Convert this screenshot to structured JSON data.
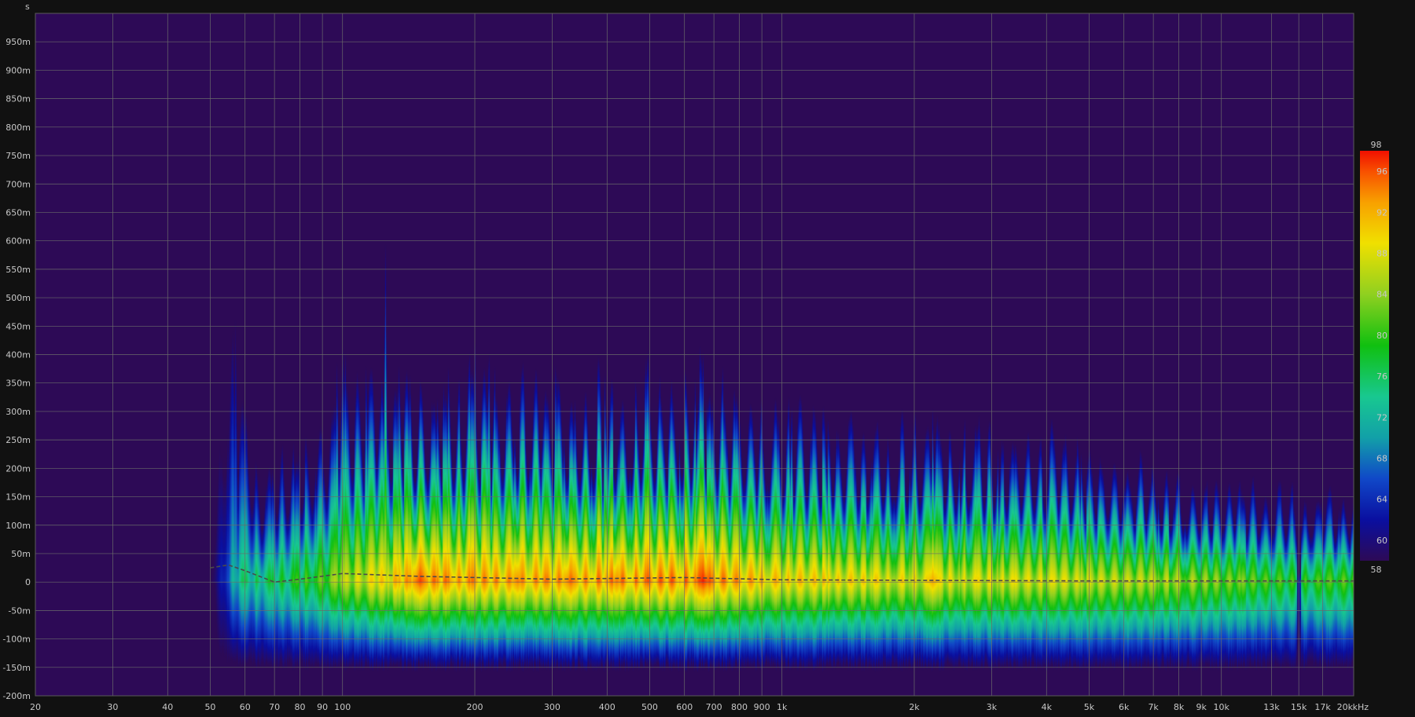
{
  "chart_data": {
    "type": "heatmap",
    "title": "",
    "y_unit_label": "s",
    "x_unit_label": "kHz",
    "xscale": "log",
    "xlim": [
      20,
      20000
    ],
    "ylim": [
      -0.2,
      1.0
    ],
    "grid": true,
    "x_ticks": [
      {
        "value": 20,
        "label": "20"
      },
      {
        "value": 30,
        "label": "30"
      },
      {
        "value": 40,
        "label": "40"
      },
      {
        "value": 50,
        "label": "50"
      },
      {
        "value": 60,
        "label": "60"
      },
      {
        "value": 70,
        "label": "70"
      },
      {
        "value": 80,
        "label": "80"
      },
      {
        "value": 90,
        "label": "90"
      },
      {
        "value": 100,
        "label": "100"
      },
      {
        "value": 200,
        "label": "200"
      },
      {
        "value": 300,
        "label": "300"
      },
      {
        "value": 400,
        "label": "400"
      },
      {
        "value": 500,
        "label": "500"
      },
      {
        "value": 600,
        "label": "600"
      },
      {
        "value": 700,
        "label": "700"
      },
      {
        "value": 800,
        "label": "800"
      },
      {
        "value": 900,
        "label": "900"
      },
      {
        "value": 1000,
        "label": "1k"
      },
      {
        "value": 2000,
        "label": "2k"
      },
      {
        "value": 3000,
        "label": "3k"
      },
      {
        "value": 4000,
        "label": "4k"
      },
      {
        "value": 5000,
        "label": "5k"
      },
      {
        "value": 6000,
        "label": "6k"
      },
      {
        "value": 7000,
        "label": "7k"
      },
      {
        "value": 8000,
        "label": "8k"
      },
      {
        "value": 9000,
        "label": "9k"
      },
      {
        "value": 10000,
        "label": "10k"
      },
      {
        "value": 13000,
        "label": "13k"
      },
      {
        "value": 15000,
        "label": "15k"
      },
      {
        "value": 17000,
        "label": "17k"
      },
      {
        "value": 20000,
        "label": "20k"
      }
    ],
    "y_ticks": [
      {
        "value": 0.95,
        "label": "950m"
      },
      {
        "value": 0.9,
        "label": "900m"
      },
      {
        "value": 0.85,
        "label": "850m"
      },
      {
        "value": 0.8,
        "label": "800m"
      },
      {
        "value": 0.75,
        "label": "750m"
      },
      {
        "value": 0.7,
        "label": "700m"
      },
      {
        "value": 0.65,
        "label": "650m"
      },
      {
        "value": 0.6,
        "label": "600m"
      },
      {
        "value": 0.55,
        "label": "550m"
      },
      {
        "value": 0.5,
        "label": "500m"
      },
      {
        "value": 0.45,
        "label": "450m"
      },
      {
        "value": 0.4,
        "label": "400m"
      },
      {
        "value": 0.35,
        "label": "350m"
      },
      {
        "value": 0.3,
        "label": "300m"
      },
      {
        "value": 0.25,
        "label": "250m"
      },
      {
        "value": 0.2,
        "label": "200m"
      },
      {
        "value": 0.15,
        "label": "150m"
      },
      {
        "value": 0.1,
        "label": "100m"
      },
      {
        "value": 0.05,
        "label": "50m"
      },
      {
        "value": 0,
        "label": "0"
      },
      {
        "value": -0.05,
        "label": "-50m"
      },
      {
        "value": -0.1,
        "label": "-100m"
      },
      {
        "value": -0.15,
        "label": "-150m"
      },
      {
        "value": -0.2,
        "label": "-200m"
      }
    ],
    "colorbar": {
      "min": 58,
      "max": 98,
      "ticks": [
        {
          "value": 98,
          "label": "98"
        },
        {
          "value": 96,
          "label": "96"
        },
        {
          "value": 92,
          "label": "92"
        },
        {
          "value": 88,
          "label": "88"
        },
        {
          "value": 84,
          "label": "84"
        },
        {
          "value": 80,
          "label": "80"
        },
        {
          "value": 76,
          "label": "76"
        },
        {
          "value": 72,
          "label": "72"
        },
        {
          "value": 68,
          "label": "68"
        },
        {
          "value": 64,
          "label": "64"
        },
        {
          "value": 60,
          "label": "60"
        },
        {
          "value": 58,
          "label": "58"
        }
      ],
      "stops": [
        {
          "value": 58,
          "color": "#2d0a56"
        },
        {
          "value": 62,
          "color": "#0a0fa0"
        },
        {
          "value": 66,
          "color": "#1048c8"
        },
        {
          "value": 70,
          "color": "#12a0a8"
        },
        {
          "value": 74,
          "color": "#18c890"
        },
        {
          "value": 79,
          "color": "#10c010"
        },
        {
          "value": 84,
          "color": "#90d020"
        },
        {
          "value": 89,
          "color": "#f0e000"
        },
        {
          "value": 93,
          "color": "#f8a000"
        },
        {
          "value": 96,
          "color": "#f85000"
        },
        {
          "value": 98,
          "color": "#f01000"
        }
      ]
    },
    "colors": {
      "background": "#111111",
      "plot_background": "#2d0a56",
      "grid": "#6a6a6a",
      "text": "#c8c8c8",
      "ridge_line": "#4a4a4a"
    },
    "onset_s": 0,
    "low_frequency_cutoff_hz": 50,
    "notch_hz": 15000,
    "decay_profile": [
      {
        "freq": 50,
        "decay_s": 0.02,
        "peak_level": 70
      },
      {
        "freq": 55,
        "decay_s": 0.47,
        "peak_level": 76
      },
      {
        "freq": 65,
        "decay_s": 0.2,
        "peak_level": 78
      },
      {
        "freq": 90,
        "decay_s": 0.3,
        "peak_level": 84
      },
      {
        "freq": 100,
        "decay_s": 0.4,
        "peak_level": 88
      },
      {
        "freq": 150,
        "decay_s": 0.38,
        "peak_level": 96
      },
      {
        "freq": 250,
        "decay_s": 0.4,
        "peak_level": 95
      },
      {
        "freq": 400,
        "decay_s": 0.38,
        "peak_level": 96
      },
      {
        "freq": 650,
        "decay_s": 0.4,
        "peak_level": 97
      },
      {
        "freq": 1000,
        "decay_s": 0.33,
        "peak_level": 93
      },
      {
        "freq": 2000,
        "decay_s": 0.3,
        "peak_level": 91
      },
      {
        "freq": 4000,
        "decay_s": 0.28,
        "peak_level": 90
      },
      {
        "freq": 8000,
        "decay_s": 0.2,
        "peak_level": 88
      },
      {
        "freq": 15000,
        "decay_s": 0.17,
        "peak_level": 82
      },
      {
        "freq": 20000,
        "decay_s": 0.16,
        "peak_level": 84
      }
    ],
    "resonance_peaks": [
      {
        "freq": 57,
        "decay_s": 0.47
      },
      {
        "freq": 97,
        "decay_s": 0.4
      },
      {
        "freq": 113,
        "decay_s": 0.4
      },
      {
        "freq": 125,
        "decay_s": 0.58
      },
      {
        "freq": 140,
        "decay_s": 0.39
      },
      {
        "freq": 200,
        "decay_s": 0.4
      },
      {
        "freq": 215,
        "decay_s": 0.43
      },
      {
        "freq": 305,
        "decay_s": 0.41
      },
      {
        "freq": 395,
        "decay_s": 0.37
      },
      {
        "freq": 660,
        "decay_s": 0.4
      },
      {
        "freq": 1050,
        "decay_s": 0.33
      },
      {
        "freq": 2200,
        "decay_s": 0.3
      }
    ],
    "hot_spots": [
      {
        "freq": 150,
        "level": 97
      },
      {
        "freq": 175,
        "level": 93
      },
      {
        "freq": 250,
        "level": 95
      },
      {
        "freq": 330,
        "level": 96
      },
      {
        "freq": 420,
        "level": 95
      },
      {
        "freq": 660,
        "level": 98
      },
      {
        "freq": 2200,
        "level": 93
      }
    ],
    "series": [
      {
        "type": "dashed_line",
        "desc_key": "ridge",
        "x": [
          50,
          55,
          60,
          70,
          80,
          100,
          150,
          300,
          600,
          1000,
          2000,
          5000,
          20000
        ],
        "y": [
          0.025,
          0.03,
          0.02,
          0.0,
          0.005,
          0.015,
          0.01,
          0.005,
          0.008,
          0.004,
          0.003,
          0.002,
          0.002
        ]
      }
    ]
  }
}
